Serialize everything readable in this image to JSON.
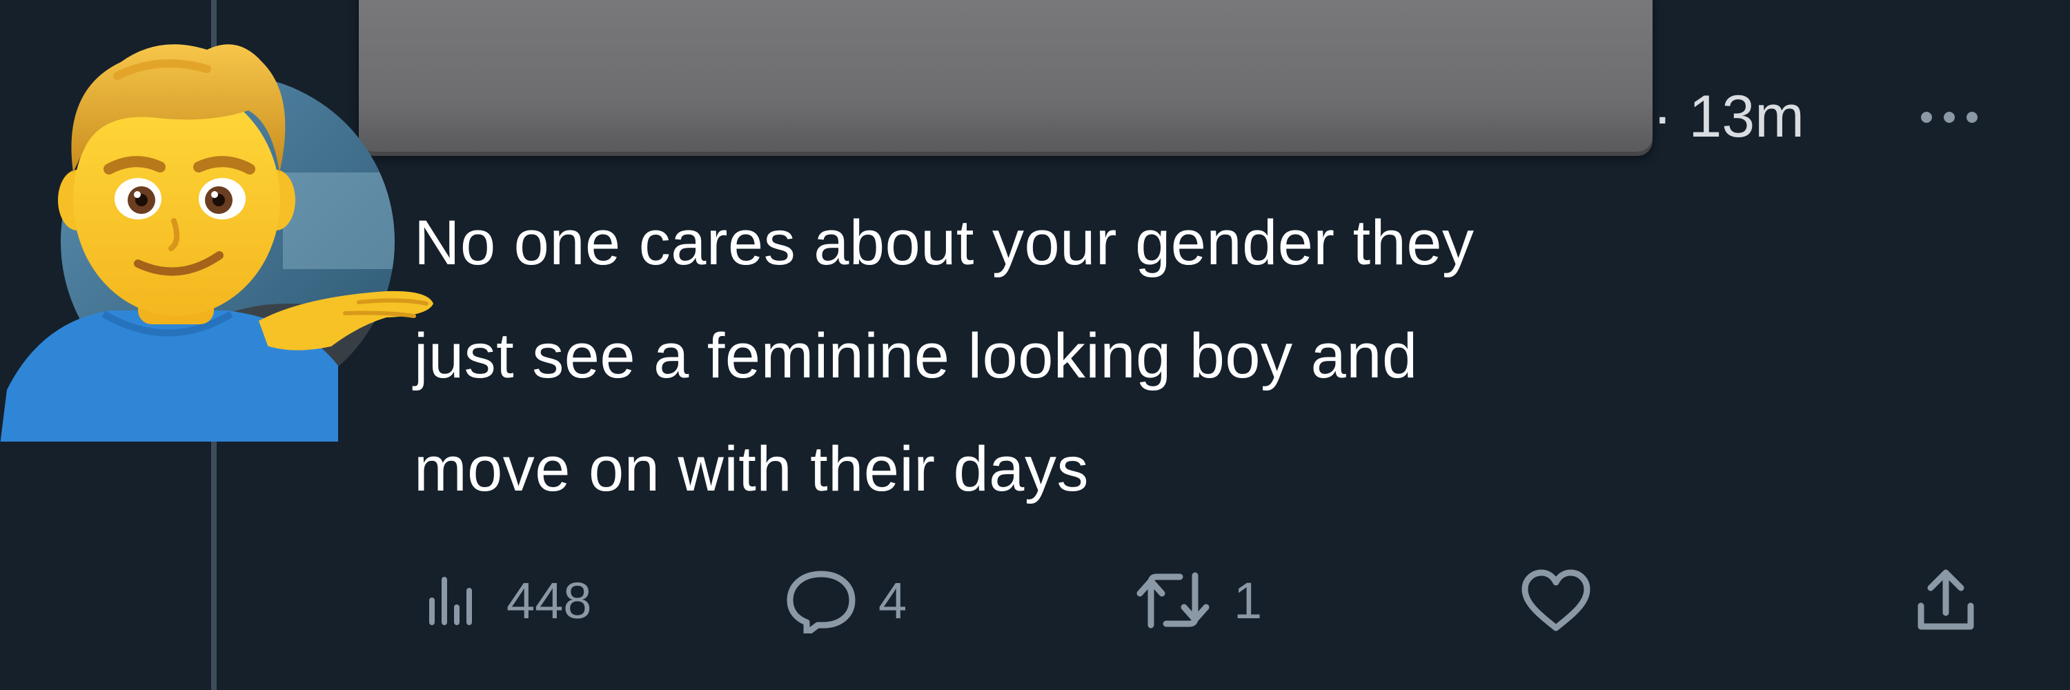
{
  "tweet": {
    "timestamp": "· 13m",
    "text_lines": [
      "No one cares about your gender they",
      "just see a feminine looking boy and",
      "move on with their days"
    ]
  },
  "actions": {
    "views": {
      "icon": "views-icon",
      "count": "448"
    },
    "reply": {
      "icon": "reply-icon",
      "count": "4"
    },
    "retweet": {
      "icon": "retweet-icon",
      "count": "1"
    },
    "like": {
      "icon": "heart-icon"
    },
    "share": {
      "icon": "share-icon"
    }
  },
  "icons": {
    "avatar": "man-tipping-hand-emoji",
    "more": "more-icon"
  },
  "colors": {
    "background": "#15202b",
    "text": "#ffffff",
    "muted": "#8b98a5",
    "thread_line": "#3e4d5c"
  }
}
